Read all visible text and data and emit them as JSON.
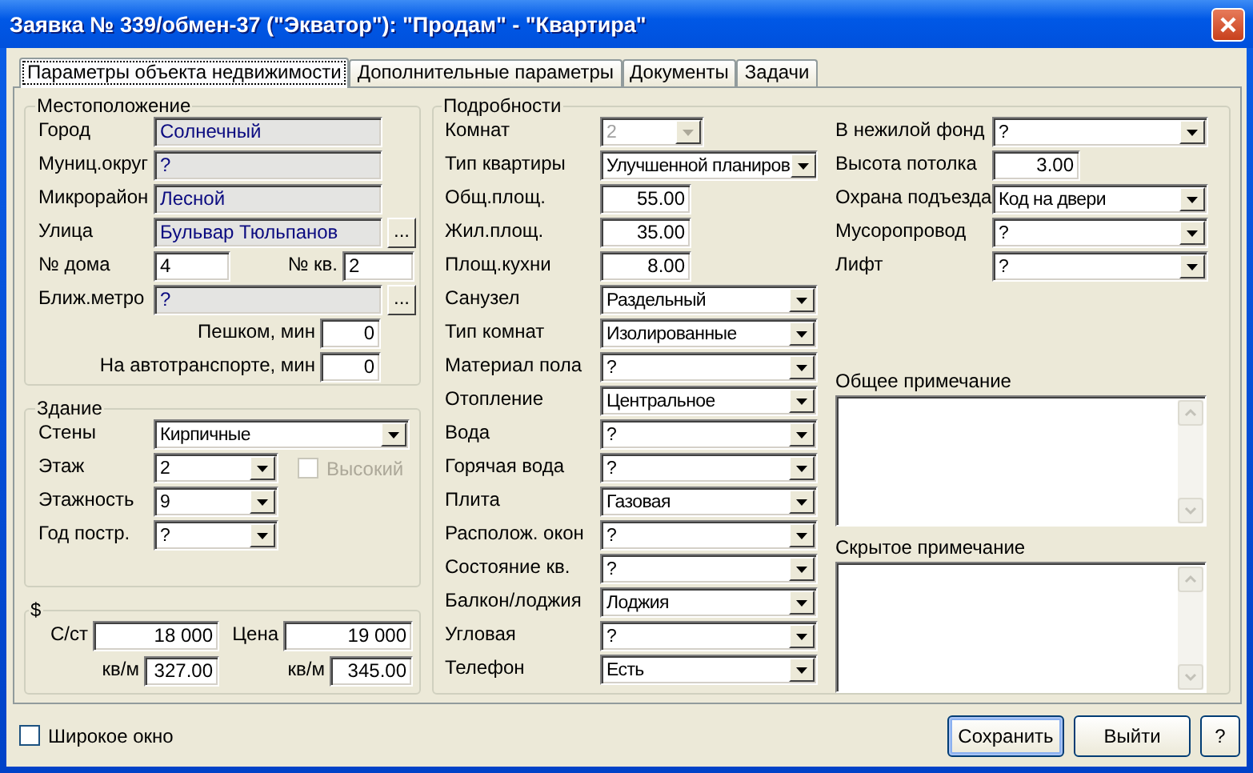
{
  "window": {
    "title": "Заявка № 339/обмен-37 (\"Экватор\"): \"Продам\" - \"Квартира\""
  },
  "tabs": [
    {
      "label": "Параметры объекта недвижимости",
      "selected": true
    },
    {
      "label": "Дополнительные параметры",
      "selected": false
    },
    {
      "label": "Документы",
      "selected": false
    },
    {
      "label": "Задачи",
      "selected": false
    }
  ],
  "location": {
    "title": "Местоположение",
    "rows": [
      {
        "kind": "lookup",
        "label": "Город",
        "value": "Солнечный"
      },
      {
        "kind": "lookup",
        "label": "Муниц.округ",
        "value": "?"
      },
      {
        "kind": "lookup",
        "label": "Микрорайон",
        "value": "Лесной"
      },
      {
        "kind": "browse",
        "label": "Улица",
        "value": "Бульвар Тюльпанов",
        "button": "..."
      },
      {
        "kind": "pair",
        "label": "№ дома",
        "value": "4",
        "label2": "№ кв.",
        "value2": "2"
      },
      {
        "kind": "browse",
        "label": "Ближ.метро",
        "value": "?",
        "button": "..."
      },
      {
        "kind": "minutes",
        "label": "Пешком, мин",
        "value": "0"
      },
      {
        "kind": "minutes",
        "label": "На автотранспорте, мин",
        "value": "0"
      }
    ]
  },
  "building": {
    "title": "Здание",
    "rows": [
      {
        "kind": "wide",
        "label": "Стены",
        "value": "Кирпичные"
      },
      {
        "kind": "narrow",
        "label": "Этаж",
        "value": "2",
        "checkbox": {
          "label": "Высокий",
          "checked": false,
          "disabled": true
        }
      },
      {
        "kind": "narrow",
        "label": "Этажность",
        "value": "9"
      },
      {
        "kind": "narrow",
        "label": "Год постр.",
        "value": "?"
      }
    ]
  },
  "price": {
    "title": "$",
    "rows": [
      {
        "kind": "total",
        "label": "С/ст",
        "value": "18 000",
        "label2": "Цена",
        "value2": "19 000"
      },
      {
        "kind": "per_meter",
        "label": "кв/м",
        "value": "327.00",
        "label2": "кв/м",
        "value2": "345.00"
      }
    ]
  },
  "details": {
    "title": "Подробности",
    "rows": [
      {
        "kind": "short",
        "label": "Комнат",
        "value": "2",
        "disabled": true
      },
      {
        "kind": "select",
        "label": "Тип квартиры",
        "value": "Улучшенной планиров",
        "disabled": false
      },
      {
        "kind": "number",
        "label": "Общ.площ.",
        "value": "55.00",
        "disabled": false
      },
      {
        "kind": "number",
        "label": "Жил.площ.",
        "value": "35.00",
        "disabled": false
      },
      {
        "kind": "number",
        "label": "Площ.кухни",
        "value": "8.00",
        "disabled": false
      },
      {
        "kind": "select",
        "label": "Санузел",
        "value": "Раздельный",
        "disabled": false
      },
      {
        "kind": "select",
        "label": "Тип комнат",
        "value": "Изолированные",
        "disabled": false
      },
      {
        "kind": "select",
        "label": "Материал пола",
        "value": "?",
        "disabled": false
      },
      {
        "kind": "select",
        "label": "Отопление",
        "value": "Центральное",
        "disabled": false
      },
      {
        "kind": "select",
        "label": "Вода",
        "value": "?",
        "disabled": false
      },
      {
        "kind": "select",
        "label": "Горячая вода",
        "value": "?",
        "disabled": false
      },
      {
        "kind": "select",
        "label": "Плита",
        "value": "Газовая",
        "disabled": false
      },
      {
        "kind": "select",
        "label": "Располож. окон",
        "value": "?",
        "disabled": false
      },
      {
        "kind": "select",
        "label": "Состояние кв.",
        "value": "?",
        "disabled": false
      },
      {
        "kind": "select",
        "label": "Балкон/лоджия",
        "value": "Лоджия",
        "disabled": false
      },
      {
        "kind": "select",
        "label": "Угловая",
        "value": "?",
        "disabled": false
      },
      {
        "kind": "select",
        "label": "Телефон",
        "value": "Есть",
        "disabled": false
      }
    ],
    "extra_rows": [
      {
        "kind": "select",
        "label": "В нежилой фонд",
        "value": "?"
      },
      {
        "kind": "number",
        "label": "Высота потолка",
        "value": "3.00"
      },
      {
        "kind": "select",
        "label": "Охрана подъезда",
        "value": "Код на двери"
      },
      {
        "kind": "select",
        "label": "Мусоропровод",
        "value": "?"
      },
      {
        "kind": "select",
        "label": "Лифт",
        "value": "?"
      }
    ],
    "notes": [
      {
        "label": "Общее примечание"
      },
      {
        "label": "Скрытое примечание"
      }
    ]
  },
  "wide_window": {
    "label": "Широкое окно",
    "checked": false
  },
  "buttons": [
    {
      "label": "Сохранить",
      "default": true
    },
    {
      "label": "Выйти",
      "default": false
    },
    {
      "label": "?",
      "default": false
    }
  ]
}
